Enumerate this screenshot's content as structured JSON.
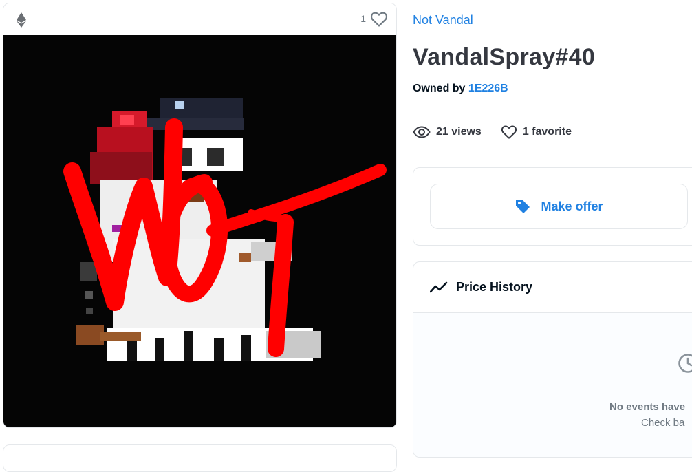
{
  "media": {
    "favorite_count": "1",
    "icons": [
      "ethereum-icon",
      "heart-icon"
    ],
    "overlay_text": "NOT"
  },
  "details": {
    "collection_name": "Not Vandal",
    "title": "VandalSpray#40",
    "owned_by_label": "Owned by",
    "owner": "1E226B",
    "views": "21 views",
    "favorites": "1 favorite"
  },
  "actions": {
    "make_offer_label": "Make offer"
  },
  "price_history": {
    "title": "Price History",
    "empty_title": "No events have",
    "empty_subtitle": "Check ba"
  },
  "colors": {
    "accent": "#2081e2",
    "text": "#04111d",
    "muted": "#707a83",
    "border": "#e5e8eb",
    "graffiti": "#ff0000"
  }
}
